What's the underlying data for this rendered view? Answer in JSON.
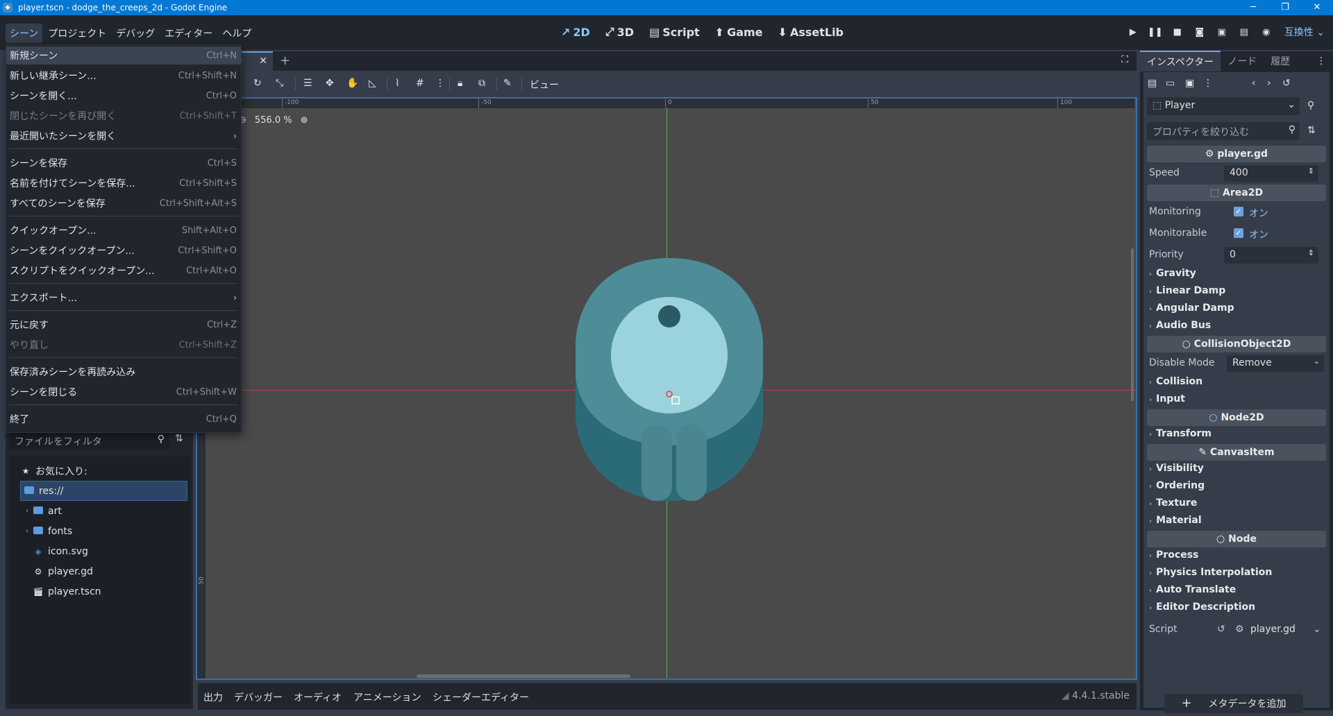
{
  "window": {
    "title": "player.tscn - dodge_the_creeps_2d - Godot Engine",
    "minimize": "─",
    "maximize": "❐",
    "close": "✕"
  },
  "menubar": [
    "シーン",
    "プロジェクト",
    "デバッグ",
    "エディター",
    "ヘルプ"
  ],
  "workspaces": [
    {
      "icon": "↗",
      "label": "2D"
    },
    {
      "icon": "⤢",
      "label": "3D"
    },
    {
      "icon": "▤",
      "label": "Script"
    },
    {
      "icon": "⬆",
      "label": "Game"
    },
    {
      "icon": "⬇",
      "label": "AssetLib"
    }
  ],
  "renderer": "互換性",
  "scene_menu": [
    {
      "label": "新規シーン",
      "shortcut": "Ctrl+N",
      "highlight": true
    },
    {
      "label": "新しい継承シーン...",
      "shortcut": "Ctrl+Shift+N"
    },
    {
      "label": "シーンを開く...",
      "shortcut": "Ctrl+O"
    },
    {
      "label": "閉じたシーンを再び開く",
      "shortcut": "Ctrl+Shift+T",
      "disabled": true
    },
    {
      "label": "最近開いたシーンを開く",
      "shortcut": "",
      "submenu": true
    },
    {
      "label": "シーンを保存",
      "shortcut": "Ctrl+S"
    },
    {
      "label": "名前を付けてシーンを保存...",
      "shortcut": "Ctrl+Shift+S"
    },
    {
      "label": "すべてのシーンを保存",
      "shortcut": "Ctrl+Shift+Alt+S"
    },
    {
      "label": "クイックオープン...",
      "shortcut": "Shift+Alt+O"
    },
    {
      "label": "シーンをクイックオープン...",
      "shortcut": "Ctrl+Shift+O"
    },
    {
      "label": "スクリプトをクイックオープン...",
      "shortcut": "Ctrl+Alt+O"
    },
    {
      "label": "エクスポート...",
      "shortcut": "",
      "submenu": true
    },
    {
      "label": "元に戻す",
      "shortcut": "Ctrl+Z"
    },
    {
      "label": "やり直し",
      "shortcut": "Ctrl+Shift+Z",
      "disabled": true
    },
    {
      "label": "保存済みシーンを再読み込み",
      "shortcut": ""
    },
    {
      "label": "シーンを閉じる",
      "shortcut": "Ctrl+Shift+W"
    },
    {
      "label": "終了",
      "shortcut": "Ctrl+Q"
    }
  ],
  "filesystem": {
    "filter_placeholder": "ファイルをフィルタ",
    "favorites": "お気に入り:",
    "items": [
      "res://",
      "art",
      "fonts",
      "icon.svg",
      "player.gd",
      "player.tscn"
    ]
  },
  "scene_tab": {
    "label": "r"
  },
  "toolbar": {
    "view_label": "ビュー"
  },
  "viewport": {
    "zoom": "556.0 %",
    "ruler_labels": [
      "-100",
      "-50",
      "0",
      "50",
      "100"
    ],
    "left_ruler_label": "50"
  },
  "bottom_panel": {
    "tabs": [
      "出力",
      "デバッガー",
      "オーディオ",
      "アニメーション",
      "シェーダーエディター"
    ],
    "version": "4.4.1.stable"
  },
  "inspector": {
    "tabs": [
      "インスペクター",
      "ノード",
      "履歴"
    ],
    "node": "Player",
    "filter_placeholder": "プロパティを絞り込む",
    "script_section": "player.gd",
    "speed_label": "Speed",
    "speed_value": "400",
    "area2d": "Area2D",
    "monitoring_label": "Monitoring",
    "monitorable_label": "Monitorable",
    "on_label": "オン",
    "priority_label": "Priority",
    "priority_value": "0",
    "groups_a": [
      "Gravity",
      "Linear Damp",
      "Angular Damp",
      "Audio Bus"
    ],
    "collision_object": "CollisionObject2D",
    "disable_mode_label": "Disable Mode",
    "disable_mode_value": "Remove",
    "groups_b": [
      "Collision",
      "Input"
    ],
    "node2d": "Node2D",
    "groups_c": [
      "Transform"
    ],
    "canvas_item": "CanvasItem",
    "groups_d": [
      "Visibility",
      "Ordering",
      "Texture",
      "Material"
    ],
    "node_section": "Node",
    "groups_e": [
      "Process",
      "Physics Interpolation",
      "Auto Translate",
      "Editor Description"
    ],
    "script_label": "Script",
    "script_value": "player.gd",
    "add_metadata": "メタデータを追加"
  },
  "colors": {
    "accent": "#8ec5ff",
    "titlebar": "#0078d4",
    "player_body": "#4f9aa6",
    "player_eye": "#9fdfe8"
  }
}
